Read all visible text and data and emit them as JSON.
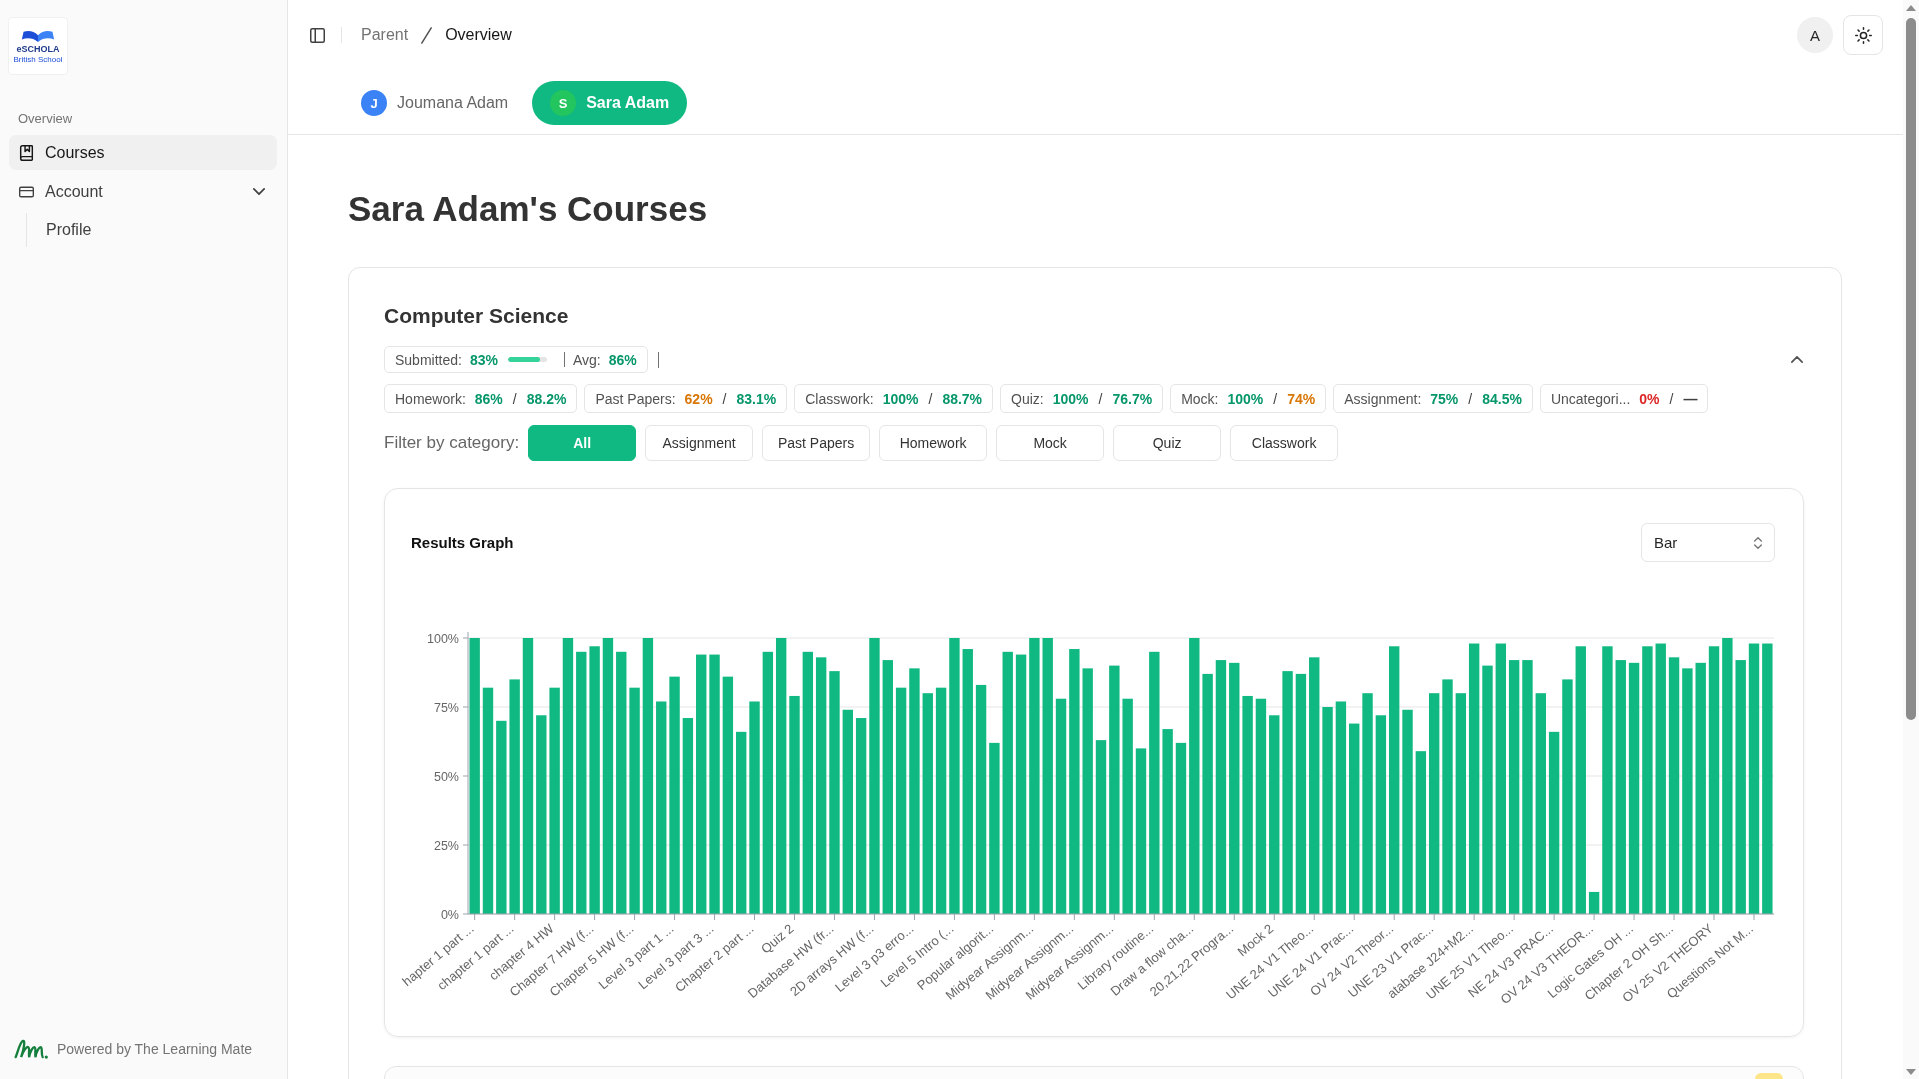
{
  "sidebar": {
    "logo": {
      "name": "eSCHOLA",
      "tagline": "British School"
    },
    "section_label": "Overview",
    "items": [
      {
        "kind": "link",
        "label": "Courses",
        "selected": true
      },
      {
        "kind": "group",
        "label": "Account",
        "selected": false,
        "expanded": true,
        "children": [
          {
            "label": "Profile",
            "selected": false
          }
        ]
      }
    ],
    "footer": "Powered by The Learning Mate"
  },
  "header": {
    "breadcrumb": [
      {
        "label": "Parent",
        "current": false
      },
      {
        "label": "Overview",
        "current": true
      }
    ],
    "user_initial": "A"
  },
  "students": [
    {
      "initial": "J",
      "name": "Joumana Adam",
      "color": "#3b82f6",
      "selected": false
    },
    {
      "initial": "S",
      "name": "Sara Adam",
      "color": "#22c55e",
      "selected": true
    }
  ],
  "page_title": "Sara Adam's Courses",
  "courses": [
    {
      "name": "Computer Science",
      "expanded": true,
      "summary": {
        "submitted_label": "Submitted:",
        "submitted": "83%",
        "level": 0.83,
        "average_label": "Avg:",
        "average": "86%"
      },
      "categories": [
        {
          "label": "Homework:",
          "score": {
            "text": "86%",
            "color": "#059669"
          },
          "separator": "/",
          "average": {
            "text": "88.2%",
            "color": "#059669"
          }
        },
        {
          "label": "Past Papers:",
          "score": {
            "text": "62%",
            "color": "#d97706"
          },
          "separator": "/",
          "average": {
            "text": "83.1%",
            "color": "#059669"
          }
        },
        {
          "label": "Classwork:",
          "score": {
            "text": "100%",
            "color": "#059669"
          },
          "separator": "/",
          "average": {
            "text": "88.7%",
            "color": "#059669"
          }
        },
        {
          "label": "Quiz:",
          "score": {
            "text": "100%",
            "color": "#059669"
          },
          "separator": "/",
          "average": {
            "text": "76.7%",
            "color": "#059669"
          }
        },
        {
          "label": "Mock:",
          "score": {
            "text": "100%",
            "color": "#059669"
          },
          "separator": "/",
          "average": {
            "text": "74%",
            "color": "#d97706"
          }
        },
        {
          "label": "Assignment:",
          "score": {
            "text": "75%",
            "color": "#059669"
          },
          "separator": "/",
          "average": {
            "text": "84.5%",
            "color": "#059669"
          }
        },
        {
          "label": "Uncategori...",
          "score": {
            "text": "0%",
            "color": "#dc2626"
          },
          "separator": "/",
          "average": {
            "text": "—",
            "color": "#404040"
          }
        }
      ],
      "filter": {
        "label": "Filter by category:",
        "options": [
          {
            "label": "All",
            "selected": true
          },
          {
            "label": "Assignment",
            "selected": false
          },
          {
            "label": "Past Papers",
            "selected": false
          },
          {
            "label": "Homework",
            "selected": false
          },
          {
            "label": "Mock",
            "selected": false
          },
          {
            "label": "Quiz",
            "selected": false
          },
          {
            "label": "Classwork",
            "selected": false
          }
        ]
      },
      "results": {
        "chart_type": "Bar",
        "chart_data": {
          "type": "bar",
          "title": "Results Graph",
          "categories": [
            "hapter 1 part ...",
            null,
            null,
            "chapter 1 part ...",
            null,
            null,
            "chapter 4 HW",
            null,
            null,
            "Chapter 7 HW (f...",
            null,
            null,
            "Chapter 5 HW (f...",
            null,
            null,
            "Level 3 part 1 ...",
            null,
            null,
            "Level 3 part 3 ...",
            null,
            null,
            "Chapter 2 part ...",
            null,
            null,
            "Quiz 2",
            null,
            null,
            "Database HW (fr...",
            null,
            null,
            "2D arrays HW (f...",
            null,
            null,
            "Level 3 p3 erro...",
            null,
            null,
            "Level 5 Intro (...",
            null,
            null,
            "Popular algorit...",
            null,
            null,
            "Midyear Assignm...",
            null,
            null,
            "Midyear Assignm...",
            null,
            null,
            "Midyear Assignm...",
            null,
            null,
            "Library routine...",
            null,
            null,
            "Draw a flow cha...",
            null,
            null,
            "20,21,22 Progra...",
            null,
            null,
            "Mock 2",
            null,
            null,
            "UNE 24 V1 Theo...",
            null,
            null,
            "UNE 24 V1 Prac...",
            null,
            null,
            "OV 24 V2 Theor...",
            null,
            null,
            "UNE 23 V1 Prac...",
            null,
            null,
            "atabase J24+M2...",
            null,
            null,
            "UNE 25 V1 Theo...",
            null,
            null,
            "NE 24 V3 PRAC...",
            null,
            null,
            "OV 24 V3 THEOR...",
            null,
            null,
            "Logic Gates OH ...",
            null,
            null,
            "Chapter 2 OH Sh...",
            null,
            null,
            "OV 25 V2 THEORY",
            null,
            null,
            "Questions Not M...",
            null
          ],
          "values": [
            100,
            82,
            70,
            85,
            100,
            72,
            82,
            100,
            95,
            97,
            100,
            95,
            82,
            100,
            77,
            86,
            71,
            94,
            94,
            86,
            66,
            77,
            95,
            100,
            79,
            95,
            93,
            88,
            74,
            71,
            100,
            92,
            82,
            89,
            80,
            82,
            100,
            96,
            83,
            62,
            95,
            94,
            100,
            100,
            78,
            96,
            89,
            63,
            90,
            78,
            60,
            95,
            67,
            62,
            100,
            87,
            92,
            91,
            79,
            78,
            72,
            88,
            87,
            93,
            75,
            77,
            69,
            80,
            72,
            97,
            74,
            59,
            80,
            85,
            80,
            98,
            90,
            98,
            92,
            92,
            80,
            66,
            85,
            97,
            8,
            97,
            92,
            91,
            97,
            98,
            93,
            89,
            91,
            97,
            100,
            92,
            98,
            98
          ],
          "ylim": [
            0,
            100
          ],
          "yticks": [
            {
              "value": 0,
              "label": "0%"
            },
            {
              "value": 25,
              "label": "25%"
            },
            {
              "value": 50,
              "label": "50%"
            },
            {
              "value": 75,
              "label": "75%"
            },
            {
              "value": 100,
              "label": "100%"
            }
          ],
          "grid": true
        }
      }
    }
  ]
}
